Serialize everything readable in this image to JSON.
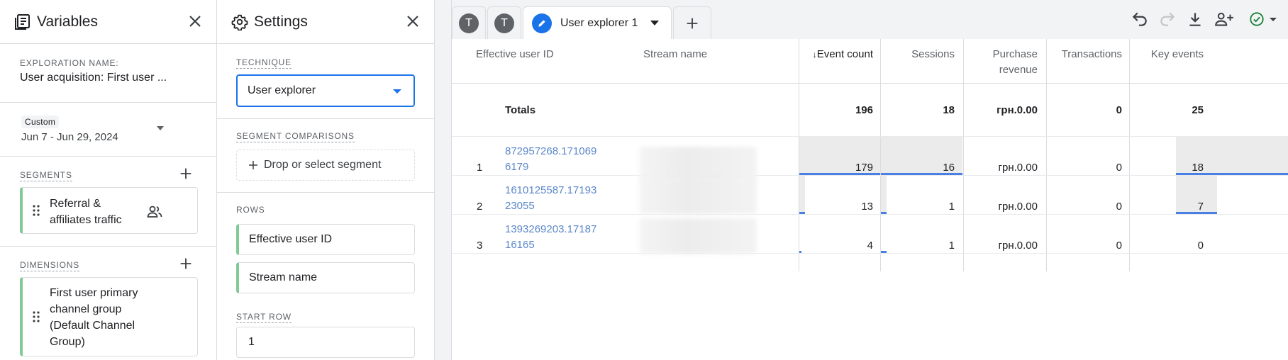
{
  "variables": {
    "title": "Variables",
    "exploration_name_caption": "EXPLORATION NAME:",
    "exploration_name": "User acquisition: First user ...",
    "date_badge": "Custom",
    "date_range": "Jun 7 - Jun 29, 2024",
    "segments_caption": "SEGMENTS",
    "segment_line1": "Referral &",
    "segment_line2": "affiliates traffic",
    "dimensions_caption": "DIMENSIONS",
    "dimension_lines": [
      "First user primary",
      "channel group",
      "(Default Channel",
      "Group)"
    ]
  },
  "settings": {
    "title": "Settings",
    "technique_caption": "TECHNIQUE",
    "technique_value": "User explorer",
    "segment_comparisons_caption": "SEGMENT COMPARISONS",
    "drop_label": "Drop or select segment",
    "rows_caption": "ROWS",
    "rows": [
      "Effective user ID",
      "Stream name"
    ],
    "start_row_caption": "START ROW",
    "start_row_value": "1"
  },
  "tabs": {
    "tab1_avatar": "T",
    "tab2_avatar": "T",
    "active_label": "User explorer 1"
  },
  "table": {
    "headers": {
      "user_id": "Effective user ID",
      "stream": "Stream name",
      "event_count": "Event count",
      "sort_arrow": "↓",
      "sessions": "Sessions",
      "purchase_line1": "Purchase",
      "purchase_line2": "revenue",
      "transactions": "Transactions",
      "key_events": "Key events"
    },
    "totals": {
      "label": "Totals",
      "event_count": "196",
      "sessions": "18",
      "purchase": "грн.0.00",
      "transactions": "0",
      "key_events": "25"
    },
    "rows": [
      {
        "num": "1",
        "uid_line1": "872957268.171069",
        "uid_line2": "6179",
        "event_count": "179",
        "sessions": "16",
        "purchase": "грн.0.00",
        "transactions": "0",
        "key_events": "18"
      },
      {
        "num": "2",
        "uid_line1": "1610125587.17193",
        "uid_line2": "23055",
        "event_count": "13",
        "sessions": "1",
        "purchase": "грн.0.00",
        "transactions": "0",
        "key_events": "7"
      },
      {
        "num": "3",
        "uid_line1": "1393269203.17187",
        "uid_line2": "16165",
        "event_count": "4",
        "sessions": "1",
        "purchase": "грн.0.00",
        "transactions": "0",
        "key_events": "0"
      }
    ]
  },
  "icons": [
    "variables-icon",
    "close-icon",
    "chevron-down-icon",
    "add-icon",
    "drag-handle-icon",
    "people-icon",
    "settings-gear-icon",
    "pencil-icon",
    "undo-icon",
    "redo-icon",
    "download-icon",
    "share-icon",
    "check-circle-icon"
  ],
  "colors": {
    "accent": "#1a73e8",
    "chip_green": "#81c995",
    "link": "#5b87c9",
    "bar": "#4a7fe3",
    "check": "#188038"
  }
}
